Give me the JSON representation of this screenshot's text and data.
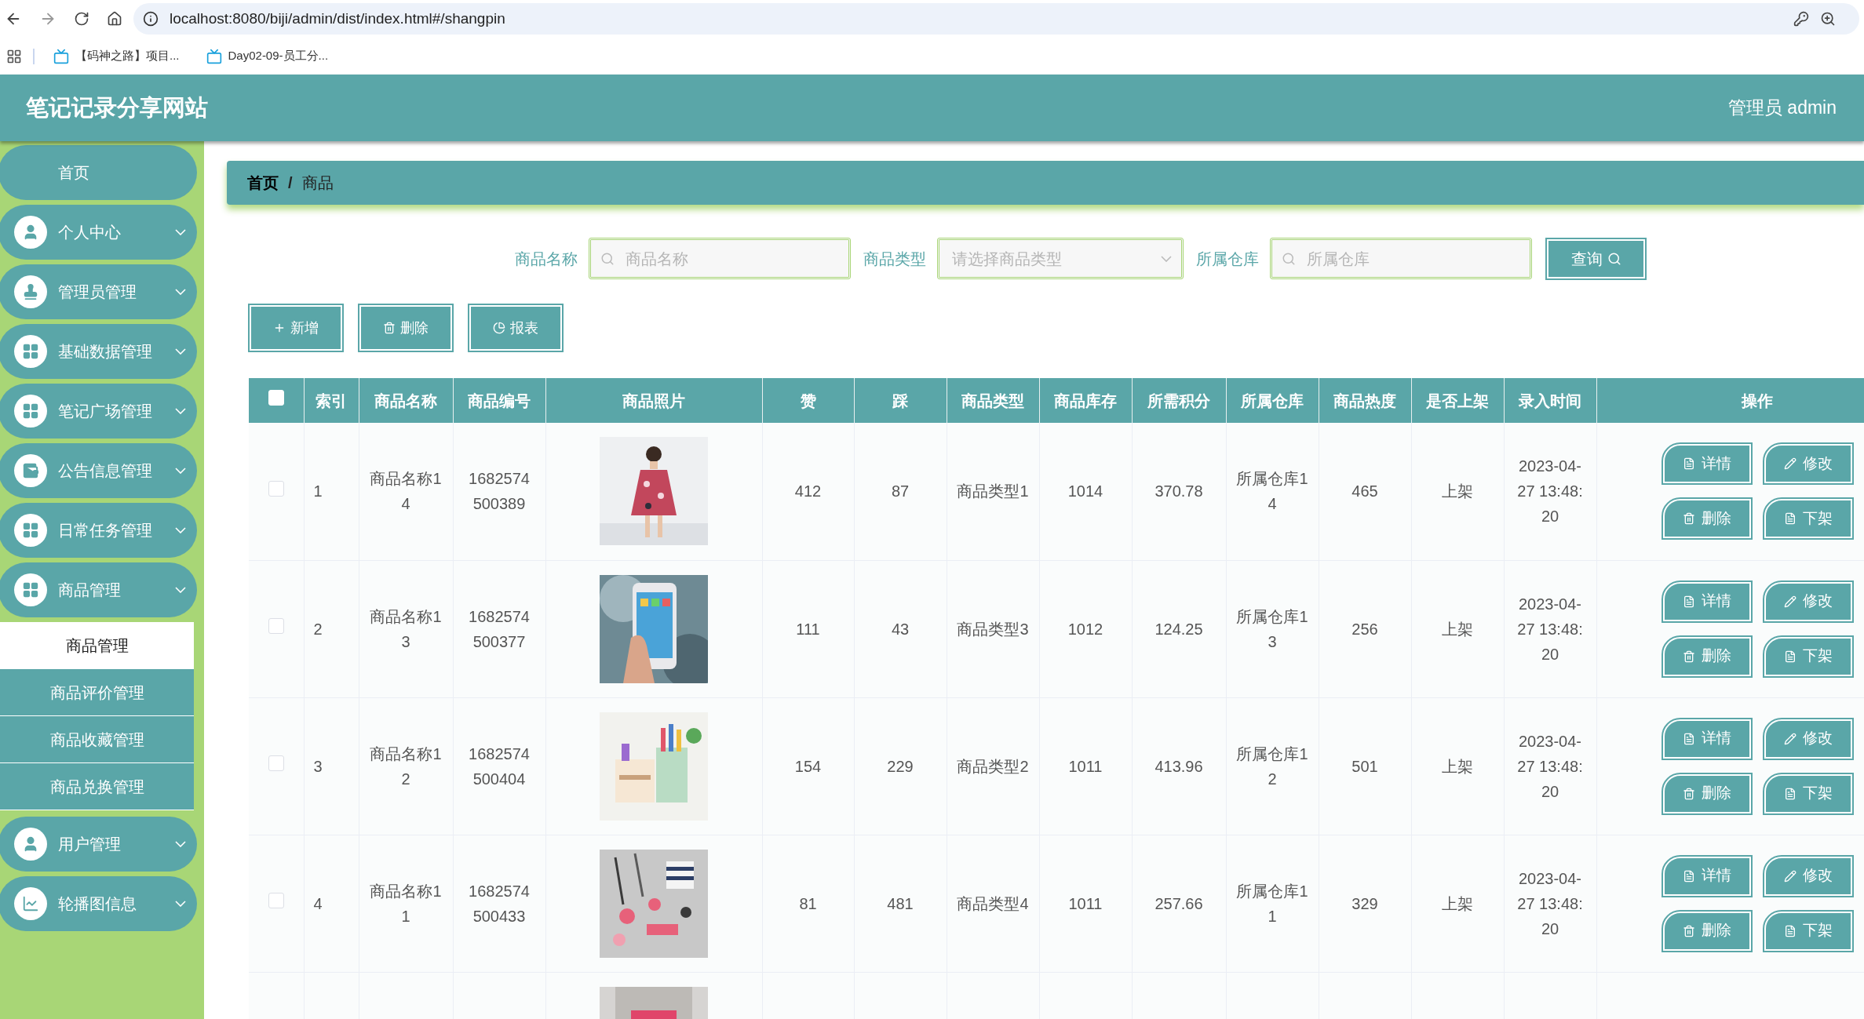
{
  "browser": {
    "address": "localhost:8080/biji/admin/dist/index.html#/shangpin",
    "bookmarks": [
      "【码神之路】项目...",
      "Day02-09-员工分..."
    ]
  },
  "header": {
    "title": "笔记记录分享网站",
    "user": "管理员 admin"
  },
  "sidebar": {
    "items": [
      {
        "label": "首页",
        "kind": "link"
      },
      {
        "label": "个人中心",
        "kind": "menu"
      },
      {
        "label": "管理员管理",
        "kind": "menu"
      },
      {
        "label": "基础数据管理",
        "kind": "menu"
      },
      {
        "label": "笔记广场管理",
        "kind": "menu"
      },
      {
        "label": "公告信息管理",
        "kind": "menu"
      },
      {
        "label": "日常任务管理",
        "kind": "menu"
      },
      {
        "label": "商品管理",
        "kind": "menu",
        "children": [
          {
            "label": "商品管理",
            "selected": true
          },
          {
            "label": "商品评价管理",
            "selected": false
          },
          {
            "label": "商品收藏管理",
            "selected": false
          },
          {
            "label": "商品兑换管理",
            "selected": false
          }
        ]
      },
      {
        "label": "用户管理",
        "kind": "menu"
      },
      {
        "label": "轮播图信息",
        "kind": "menu"
      }
    ]
  },
  "breadcrumb": {
    "items": [
      "首页",
      "商品"
    ],
    "separator": "/"
  },
  "search": {
    "fields": [
      {
        "label": "商品名称",
        "kind": "text",
        "placeholder": "商品名称"
      },
      {
        "label": "商品类型",
        "kind": "select",
        "placeholder": "请选择商品类型"
      },
      {
        "label": "所属仓库",
        "kind": "text",
        "placeholder": "所属仓库"
      }
    ],
    "button": "查询"
  },
  "toolbar": [
    "新增",
    "删除",
    "报表"
  ],
  "table": {
    "select_all": {
      "checked": false
    },
    "columns": [
      "索引",
      "商品名称",
      "商品编号",
      "商品照片",
      "赞",
      "踩",
      "商品类型",
      "商品库存",
      "所需积分",
      "所属仓库",
      "商品热度",
      "是否上架",
      "录入时间",
      "操作"
    ],
    "rows": [
      {
        "checked": false,
        "index": "1",
        "name": "商品名称14",
        "code": "1682574500389",
        "photo": {
          "kind": "picture"
        },
        "likes": "412",
        "dislikes": "87",
        "type": "商品类型1",
        "stock": "1014",
        "points": "370.78",
        "warehouse": "所属仓库14",
        "heat": "465",
        "status": "上架",
        "time": "2023-04-27 13:48:20",
        "actions": [
          "详情",
          "修改",
          "删除",
          "下架"
        ]
      },
      {
        "checked": false,
        "index": "2",
        "name": "商品名称13",
        "code": "1682574500377",
        "photo": {
          "kind": "picture"
        },
        "likes": "111",
        "dislikes": "43",
        "type": "商品类型3",
        "stock": "1012",
        "points": "124.25",
        "warehouse": "所属仓库13",
        "heat": "256",
        "status": "上架",
        "time": "2023-04-27 13:48:20",
        "actions": [
          "详情",
          "修改",
          "删除",
          "下架"
        ]
      },
      {
        "checked": false,
        "index": "3",
        "name": "商品名称12",
        "code": "1682574500404",
        "photo": {
          "kind": "picture"
        },
        "likes": "154",
        "dislikes": "229",
        "type": "商品类型2",
        "stock": "1011",
        "points": "413.96",
        "warehouse": "所属仓库12",
        "heat": "501",
        "status": "上架",
        "time": "2023-04-27 13:48:20",
        "actions": [
          "详情",
          "修改",
          "删除",
          "下架"
        ]
      },
      {
        "checked": false,
        "index": "4",
        "name": "商品名称11",
        "code": "1682574500433",
        "photo": {
          "kind": "picture"
        },
        "likes": "81",
        "dislikes": "481",
        "type": "商品类型4",
        "stock": "1011",
        "points": "257.66",
        "warehouse": "所属仓库11",
        "heat": "329",
        "status": "上架",
        "time": "2023-04-27 13:48:20",
        "actions": [
          "详情",
          "修改",
          "删除",
          "下架"
        ]
      },
      {
        "photo": {
          "kind": "picture"
        }
      }
    ]
  }
}
